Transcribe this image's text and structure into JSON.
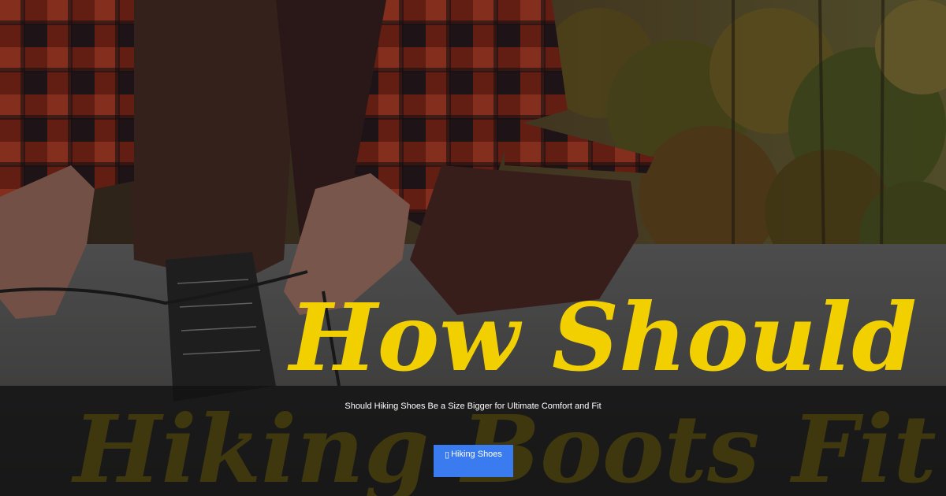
{
  "hero": {
    "title_line1": "How Should",
    "title_line2": "Hiking Boots Fit?",
    "title_color": "#f2d000"
  },
  "caption": {
    "text": "Should Hiking Shoes Be a Size Bigger for Ultimate Comfort and Fit"
  },
  "category_button": {
    "icon": "folder-icon",
    "icon_glyph": "▯",
    "label": "Hiking Shoes",
    "color": "#3a7bf0"
  }
}
